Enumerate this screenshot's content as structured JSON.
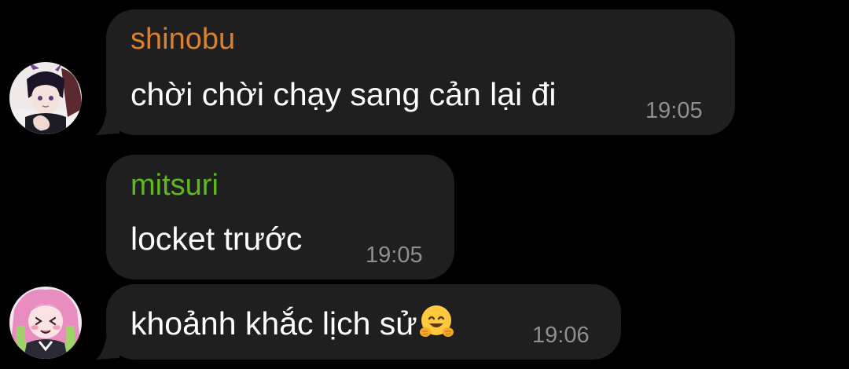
{
  "messages": [
    {
      "sender": "shinobu",
      "sender_color": "#d8812e",
      "text": "chời chời chạy sang cản lại đi",
      "time": "19:05"
    },
    {
      "sender": "mitsuri",
      "sender_color": "#5fb81e",
      "text": "locket trước",
      "time": "19:05"
    },
    {
      "text": "khoảnh khắc lịch sử",
      "emoji": "hugging-face",
      "time": "19:06"
    }
  ],
  "avatars": [
    {
      "icon": "shinobu-avatar",
      "user": "shinobu"
    },
    {
      "icon": "mitsuri-avatar",
      "user": "mitsuri"
    }
  ],
  "colors": {
    "background": "#000000",
    "bubble": "#1f1f1f",
    "text": "#ffffff",
    "time": "#8e8e93"
  }
}
